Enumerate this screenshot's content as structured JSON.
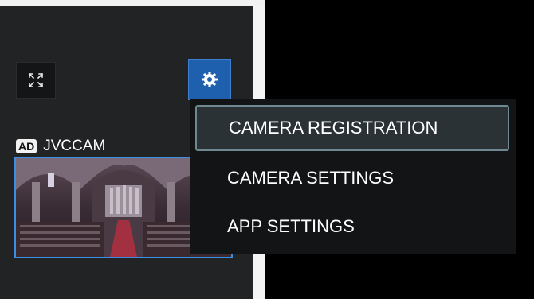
{
  "left_panel": {
    "fullscreen_icon": "expand-arrows-icon",
    "settings_icon": "gear-icon",
    "camera": {
      "badge": "AD",
      "name": "JVCCAM"
    }
  },
  "settings_menu": {
    "items": [
      {
        "label": "CAMERA REGISTRATION",
        "selected": true
      },
      {
        "label": "CAMERA SETTINGS",
        "selected": false
      },
      {
        "label": "APP SETTINGS",
        "selected": false
      }
    ]
  },
  "colors": {
    "accent_blue": "#1e5fae",
    "thumb_border": "#3a8ee6",
    "menu_bg": "#131416",
    "selected_item_bg": "#2a3236"
  }
}
